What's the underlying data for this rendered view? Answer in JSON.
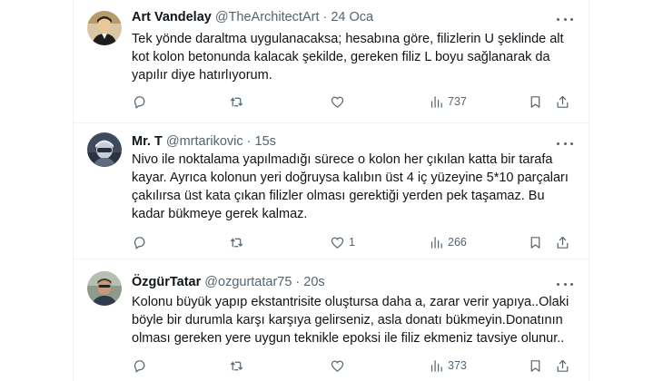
{
  "tweets": [
    {
      "name": "Art Vandelay",
      "handle": "@TheArchitectArt",
      "separator": "·",
      "time": "24 Oca",
      "lines": [
        "Tek yönde daraltma uygulanacaksa; hesabına göre, filizlerin U şeklinde alt",
        "kot kolon betonunda kalacak şekilde, gereken filiz L boyu sağlanarak da",
        "yapılır diye hatırlıyorum."
      ],
      "likes": "",
      "views": "737",
      "avatar_icon": "man-avatar-icon"
    },
    {
      "name": "Mr. T",
      "handle": "@mrtarikovic",
      "separator": "·",
      "time": "15s",
      "lines": [
        "Nivo ile noktalama yapılmadığı sürece o kolon her çıkılan katta bir tarafa",
        "kayar. Ayrıca kolonun yeri doğruysa kalıbın üst 4 iç yüzeyine 5*10 parçaları",
        "çakılırsa üst kata çıkan filizler olması gerektiği yerden pek taşamaz. Bu",
        "kadar bükmeye gerek kalmaz."
      ],
      "likes": "1",
      "views": "266",
      "avatar_icon": "helmet-avatar-icon"
    },
    {
      "name": "ÖzgürTatar",
      "handle": "@ozgurtatar75",
      "separator": "·",
      "time": "20s",
      "lines": [
        "Kolonu büyük yapıp ekstantrisite oluştursa daha a, zarar verir yapıya..Olaki",
        "böyle bir durumla karşı karşıya gelirseniz, asla donatı bükmeyin.Donatının",
        "olması gereken yere uygun teknikle epoksi ile filiz ekmeniz tavsiye olunur.."
      ],
      "likes": "",
      "views": "373",
      "avatar_icon": "person-avatar-icon"
    }
  ],
  "icons": {
    "reply": "reply-icon",
    "retweet": "retweet-icon",
    "like": "heart-icon",
    "views": "views-icon",
    "bookmark": "bookmark-icon",
    "share": "share-icon",
    "more": "more-icon"
  },
  "colors": {
    "text": "#0f1419",
    "secondary": "#536471",
    "divider": "#eff3f4",
    "background": "#ffffff"
  }
}
